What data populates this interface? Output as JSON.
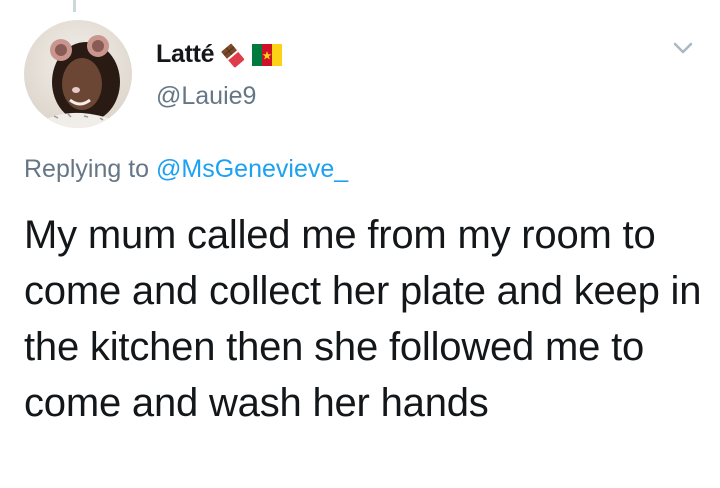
{
  "tweet": {
    "display_name": "Latté",
    "name_emojis": [
      "chocolate-bar-icon",
      "cameroon-flag-icon"
    ],
    "handle": "@Lauie9",
    "replying_prefix": "Replying to ",
    "replying_to": "@MsGenevieve_",
    "text": "My mum called me from my room to come and collect her plate and keep in the kitchen then she followed me to come and wash her hands"
  },
  "colors": {
    "text": "#14171a",
    "secondary": "#657786",
    "link": "#1da1f2"
  }
}
